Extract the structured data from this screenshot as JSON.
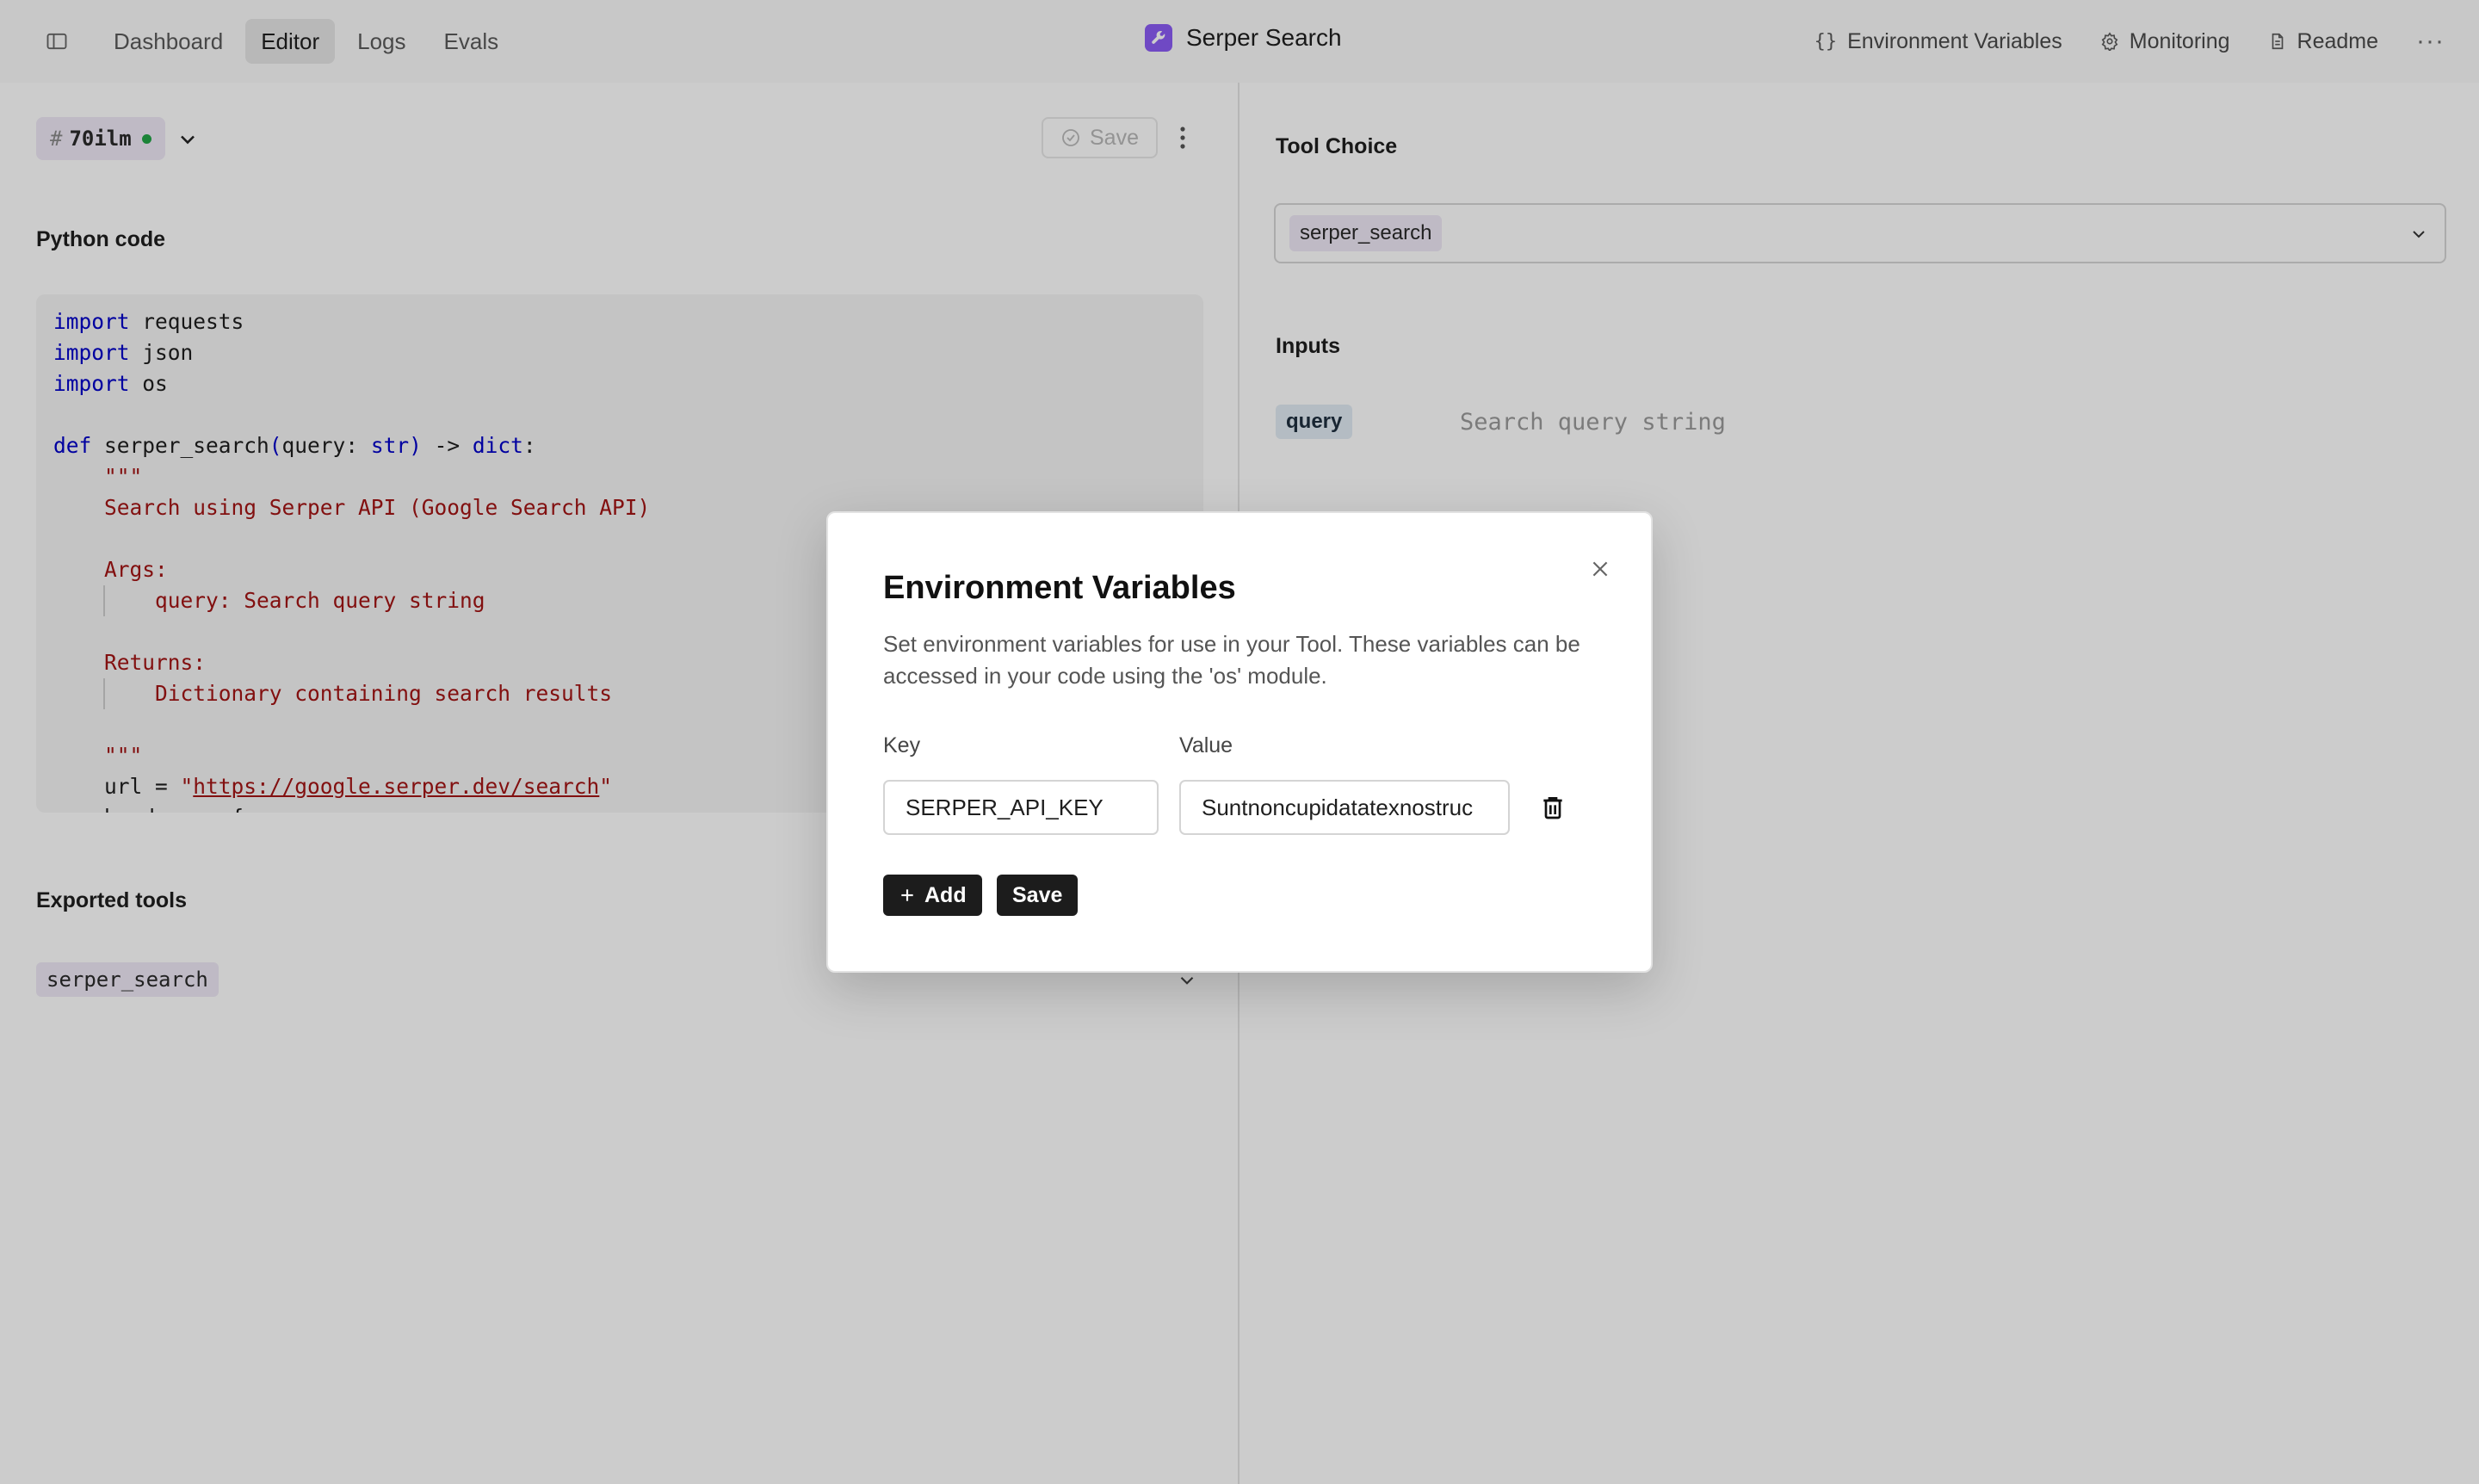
{
  "topbar": {
    "tabs": [
      {
        "label": "Dashboard"
      },
      {
        "label": "Editor"
      },
      {
        "label": "Logs"
      },
      {
        "label": "Evals"
      }
    ],
    "active_tab": "Editor",
    "title": "Serper Search",
    "actions": {
      "env_vars": "Environment Variables",
      "monitoring": "Monitoring",
      "readme": "Readme"
    }
  },
  "editor": {
    "version": {
      "hash": "#",
      "id": "70ilm"
    },
    "save_label": "Save",
    "python_code_label": "Python code",
    "exported_tools_label": "Exported tools",
    "exported_tool": "serper_search"
  },
  "right": {
    "tool_choice_label": "Tool Choice",
    "tool_choice_value": "serper_search",
    "inputs_label": "Inputs",
    "input_name": "query",
    "input_placeholder": "Search query string"
  },
  "modal": {
    "title": "Environment Variables",
    "description": "Set environment variables for use in your Tool. These variables can be accessed in your code using the 'os' module.",
    "key_label": "Key",
    "value_label": "Value",
    "key_value": "SERPER_API_KEY",
    "value_value": "Suntnoncupidatatexnostruc",
    "add_label": "Add",
    "save_label": "Save"
  },
  "colors": {
    "accent": "#8b5cf6",
    "status_dot": "#22a447",
    "chip_purple": "#efe9f7",
    "chip_blue": "#e1ecf4"
  }
}
